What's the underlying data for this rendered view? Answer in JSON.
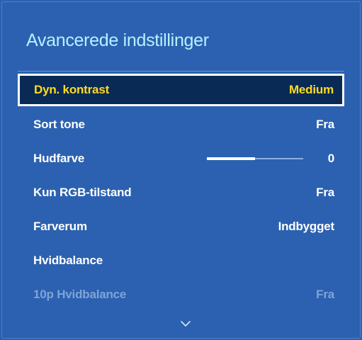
{
  "panel": {
    "title": "Avancerede indstillinger"
  },
  "settings": [
    {
      "label": "Dyn. kontrast",
      "value": "Medium",
      "selected": true
    },
    {
      "label": "Sort tone",
      "value": "Fra"
    },
    {
      "label": "Hudfarve",
      "value": "0",
      "slider_fraction": 0.5
    },
    {
      "label": "Kun RGB-tilstand",
      "value": "Fra"
    },
    {
      "label": "Farverum",
      "value": "Indbygget"
    },
    {
      "label": "Hvidbalance",
      "value": ""
    },
    {
      "label": "10p Hvidbalance",
      "value": "Fra",
      "disabled": true
    }
  ],
  "scroll_icon": "chevron-down-icon",
  "colors": {
    "background": "#2b61b0",
    "title": "#b9f0ff",
    "selected_text": "#ffdc1e",
    "selected_bg": "#0a2a56",
    "disabled_text": "#7fa4d8"
  }
}
